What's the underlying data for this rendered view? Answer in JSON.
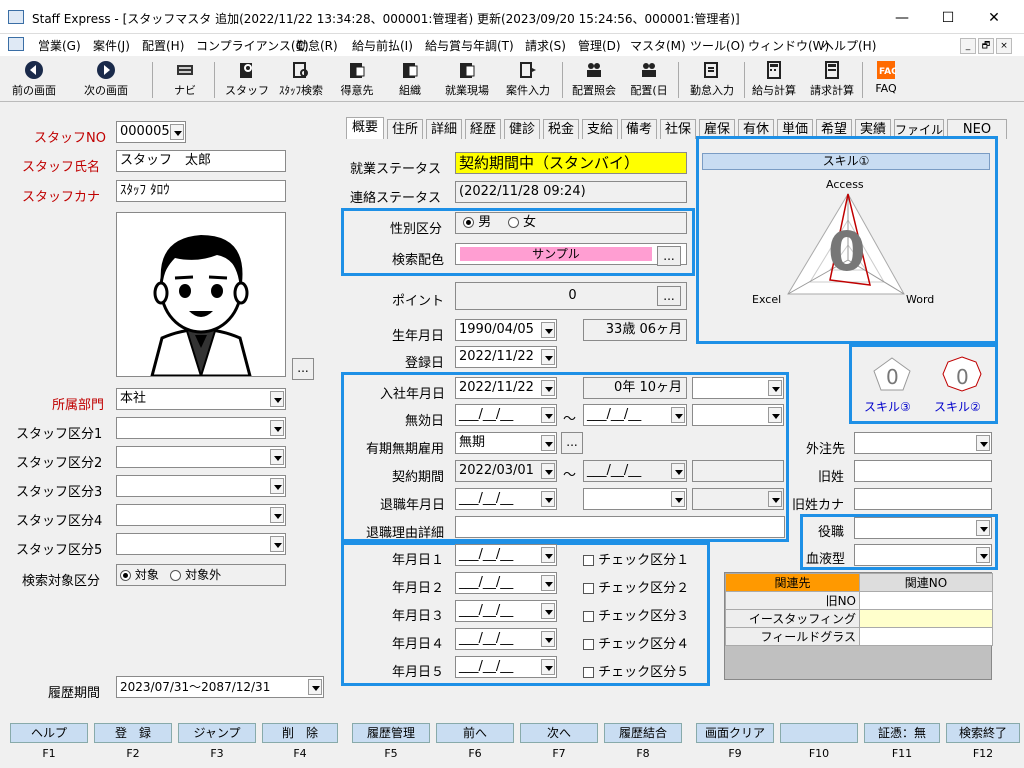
{
  "window": {
    "title": "Staff Express - [スタッフマスタ 追加(2022/11/22 13:34:28、000001:管理者) 更新(2023/09/20 15:24:56、000001:管理者)]",
    "min": "—",
    "max": "☐",
    "close": "✕"
  },
  "menu": [
    "営業(G)",
    "案件(J)",
    "配置(H)",
    "コンプライアンス(C)",
    "勤怠(R)",
    "給与前払(I)",
    "給与賞与年調(T)",
    "請求(S)",
    "管理(D)",
    "マスタ(M)",
    "ツール(O)",
    "ウィンドウ(W)",
    "ヘルプ(H)"
  ],
  "mdi": {
    "min": "_",
    "restore": "🗗",
    "close": "×"
  },
  "toolbar": [
    "前の画面",
    "次の画面",
    "ナビ",
    "スタッフ",
    "ｽﾀｯﾌ検索",
    "得意先",
    "組織",
    "就業現場",
    "案件入力",
    "配置照会",
    "配置(日",
    "勤怠入力",
    "給与計算",
    "請求計算",
    "FAQ"
  ],
  "left": {
    "staff_no_label": "スタッフNO",
    "staff_no": "000005",
    "name_label": "スタッフ氏名",
    "name": "スタッフ　太郎",
    "kana_label": "スタッフカナ",
    "kana": "ｽﾀｯﾌ ﾀﾛｳ",
    "photo_btn": "...",
    "dept_label": "所属部門",
    "dept": "本社",
    "kubun": [
      "スタッフ区分1",
      "スタッフ区分2",
      "スタッフ区分3",
      "スタッフ区分4",
      "スタッフ区分5"
    ],
    "search_label": "検索対象区分",
    "search_opt1": "対象",
    "search_opt2": "対象外",
    "history_label": "履歴期間",
    "history": "2023/07/31～2087/12/31"
  },
  "tabs": [
    "概要",
    "住所",
    "詳細",
    "経歴",
    "健診",
    "税金",
    "支給",
    "備考",
    "社保",
    "雇保",
    "有休",
    "単価",
    "希望",
    "実績",
    "ファイル",
    "NEO"
  ],
  "overview": {
    "work_status_label": "就業ステータス",
    "work_status": "契約期間中（スタンバイ）",
    "contact_status_label": "連絡ステータス",
    "contact_status": "(2022/11/28 09:24)",
    "gender_label": "性別区分",
    "male": "男",
    "female": "女",
    "color_label": "検索配色",
    "color_value": "サンプル",
    "color_btn": "...",
    "point_label": "ポイント",
    "point": "0",
    "point_btn": "...",
    "birth_label": "生年月日",
    "birth": "1990/04/05",
    "age": "33歳 06ヶ月",
    "reg_label": "登録日",
    "reg": "2022/11/22",
    "join_label": "入社年月日",
    "join": "2022/11/22",
    "tenure": "0年 10ヶ月",
    "invalid_label": "無効日",
    "empty_date": "___/__/__",
    "tilde": "～",
    "term_label": "有期無期雇用",
    "term": "無期",
    "term_btn": "...",
    "contract_label": "契約期間",
    "contract": "2022/03/01",
    "retire_label": "退職年月日",
    "retire_reason_label": "退職理由詳細",
    "dates": [
      "年月日１",
      "年月日２",
      "年月日３",
      "年月日４",
      "年月日５"
    ],
    "checks": [
      "チェック区分１",
      "チェック区分２",
      "チェック区分３",
      "チェック区分４",
      "チェック区分５"
    ]
  },
  "skill": {
    "title": "スキル①",
    "axis_top": "Access",
    "axis_left": "Excel",
    "axis_right": "Word",
    "score": "0",
    "mini1": "スキル③",
    "mini2": "スキル②"
  },
  "right": {
    "outsource_label": "外注先",
    "oldname_label": "旧姓",
    "oldkana_label": "旧姓カナ",
    "post_label": "役職",
    "blood_label": "血液型"
  },
  "related": {
    "h1": "関連先",
    "h2": "関連NO",
    "rows": [
      "旧NO",
      "イースタッフィング",
      "フィールドグラス"
    ]
  },
  "fkeys": [
    {
      "label": "ヘルプ",
      "key": "F1"
    },
    {
      "label": "登　録",
      "key": "F2"
    },
    {
      "label": "ジャンプ",
      "key": "F3"
    },
    {
      "label": "削　除",
      "key": "F4"
    },
    {
      "label": "履歴管理",
      "key": "F5"
    },
    {
      "label": "前へ",
      "key": "F6"
    },
    {
      "label": "次へ",
      "key": "F7"
    },
    {
      "label": "履歴結合",
      "key": "F8"
    },
    {
      "label": "画面クリア",
      "key": "F9"
    },
    {
      "label": "",
      "key": "F10"
    },
    {
      "label": "証憑：無",
      "key": "F11"
    },
    {
      "label": "検索終了",
      "key": "F12"
    }
  ],
  "colors": {
    "accent": "#1e90e6",
    "status_yellow": "#ffff00",
    "sample_pink": "#ff9ed2",
    "skill_bar": "#c8dcf2",
    "related_header": "#ff9900"
  }
}
